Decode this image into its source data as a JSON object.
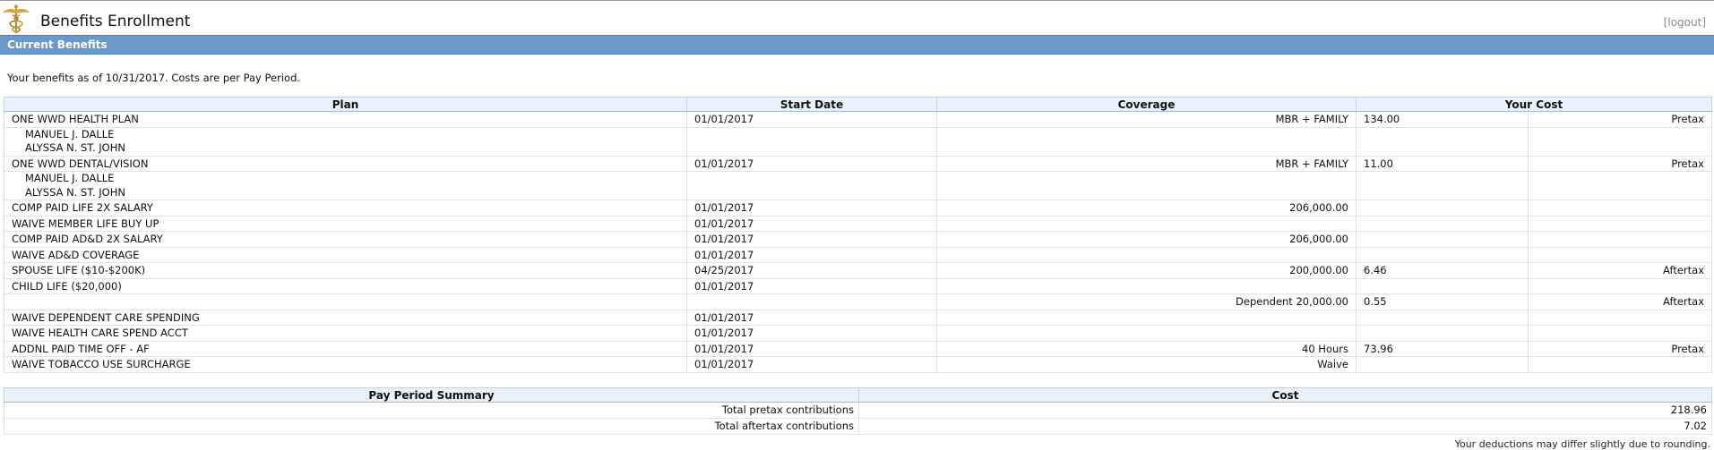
{
  "header": {
    "title": "Benefits Enrollment",
    "logout": "[logout]"
  },
  "section": {
    "title": "Current Benefits"
  },
  "intro": "Your benefits as of 10/31/2017. Costs are per Pay Period.",
  "benefits": {
    "columns": [
      "Plan",
      "Start Date",
      "Coverage",
      "Your Cost"
    ],
    "rows": [
      {
        "plan": "ONE WWD HEALTH PLAN",
        "start": "01/01/2017",
        "coverage": "MBR + FAMILY",
        "cost": "134.00",
        "tax": "Pretax"
      },
      {
        "deps": [
          "MANUEL J. DALLE",
          "ALYSSA N. ST. JOHN"
        ]
      },
      {
        "plan": "ONE WWD DENTAL/VISION",
        "start": "01/01/2017",
        "coverage": "MBR + FAMILY",
        "cost": "11.00",
        "tax": "Pretax"
      },
      {
        "deps": [
          "MANUEL J. DALLE",
          "ALYSSA N. ST. JOHN"
        ]
      },
      {
        "plan": "COMP PAID LIFE 2X SALARY",
        "start": "01/01/2017",
        "coverage": "206,000.00",
        "cost": "",
        "tax": ""
      },
      {
        "plan": "WAIVE MEMBER LIFE BUY UP",
        "start": "01/01/2017",
        "coverage": "",
        "cost": "",
        "tax": ""
      },
      {
        "plan": "COMP PAID AD&D 2X SALARY",
        "start": "01/01/2017",
        "coverage": "206,000.00",
        "cost": "",
        "tax": ""
      },
      {
        "plan": "WAIVE AD&D COVERAGE",
        "start": "01/01/2017",
        "coverage": "",
        "cost": "",
        "tax": ""
      },
      {
        "plan": "SPOUSE LIFE ($10-$200K)",
        "start": "04/25/2017",
        "coverage": "200,000.00",
        "cost": "6.46",
        "tax": "Aftertax"
      },
      {
        "plan": "CHILD LIFE ($20,000)",
        "start": "01/01/2017",
        "coverage": "",
        "cost": "",
        "tax": ""
      },
      {
        "plan": "",
        "start": "",
        "coverage": "Dependent  20,000.00",
        "cost": "0.55",
        "tax": "Aftertax"
      },
      {
        "plan": "WAIVE DEPENDENT CARE SPENDING",
        "start": "01/01/2017",
        "coverage": "",
        "cost": "",
        "tax": ""
      },
      {
        "plan": "WAIVE HEALTH CARE SPEND ACCT",
        "start": "01/01/2017",
        "coverage": "",
        "cost": "",
        "tax": ""
      },
      {
        "plan": "ADDNL PAID TIME OFF - AF",
        "start": "01/01/2017",
        "coverage": "40 Hours",
        "cost": "73.96",
        "tax": "Pretax"
      },
      {
        "plan": "WAIVE TOBACCO USE SURCHARGE",
        "start": "01/01/2017",
        "coverage": "Waive",
        "cost": "",
        "tax": ""
      }
    ]
  },
  "summary": {
    "columns": [
      "Pay Period Summary",
      "Cost"
    ],
    "rows": [
      {
        "label": "Total pretax contributions",
        "value": "218.96"
      },
      {
        "label": "Total aftertax contributions",
        "value": "7.02"
      }
    ],
    "note": "Your deductions may differ slightly due to rounding."
  }
}
